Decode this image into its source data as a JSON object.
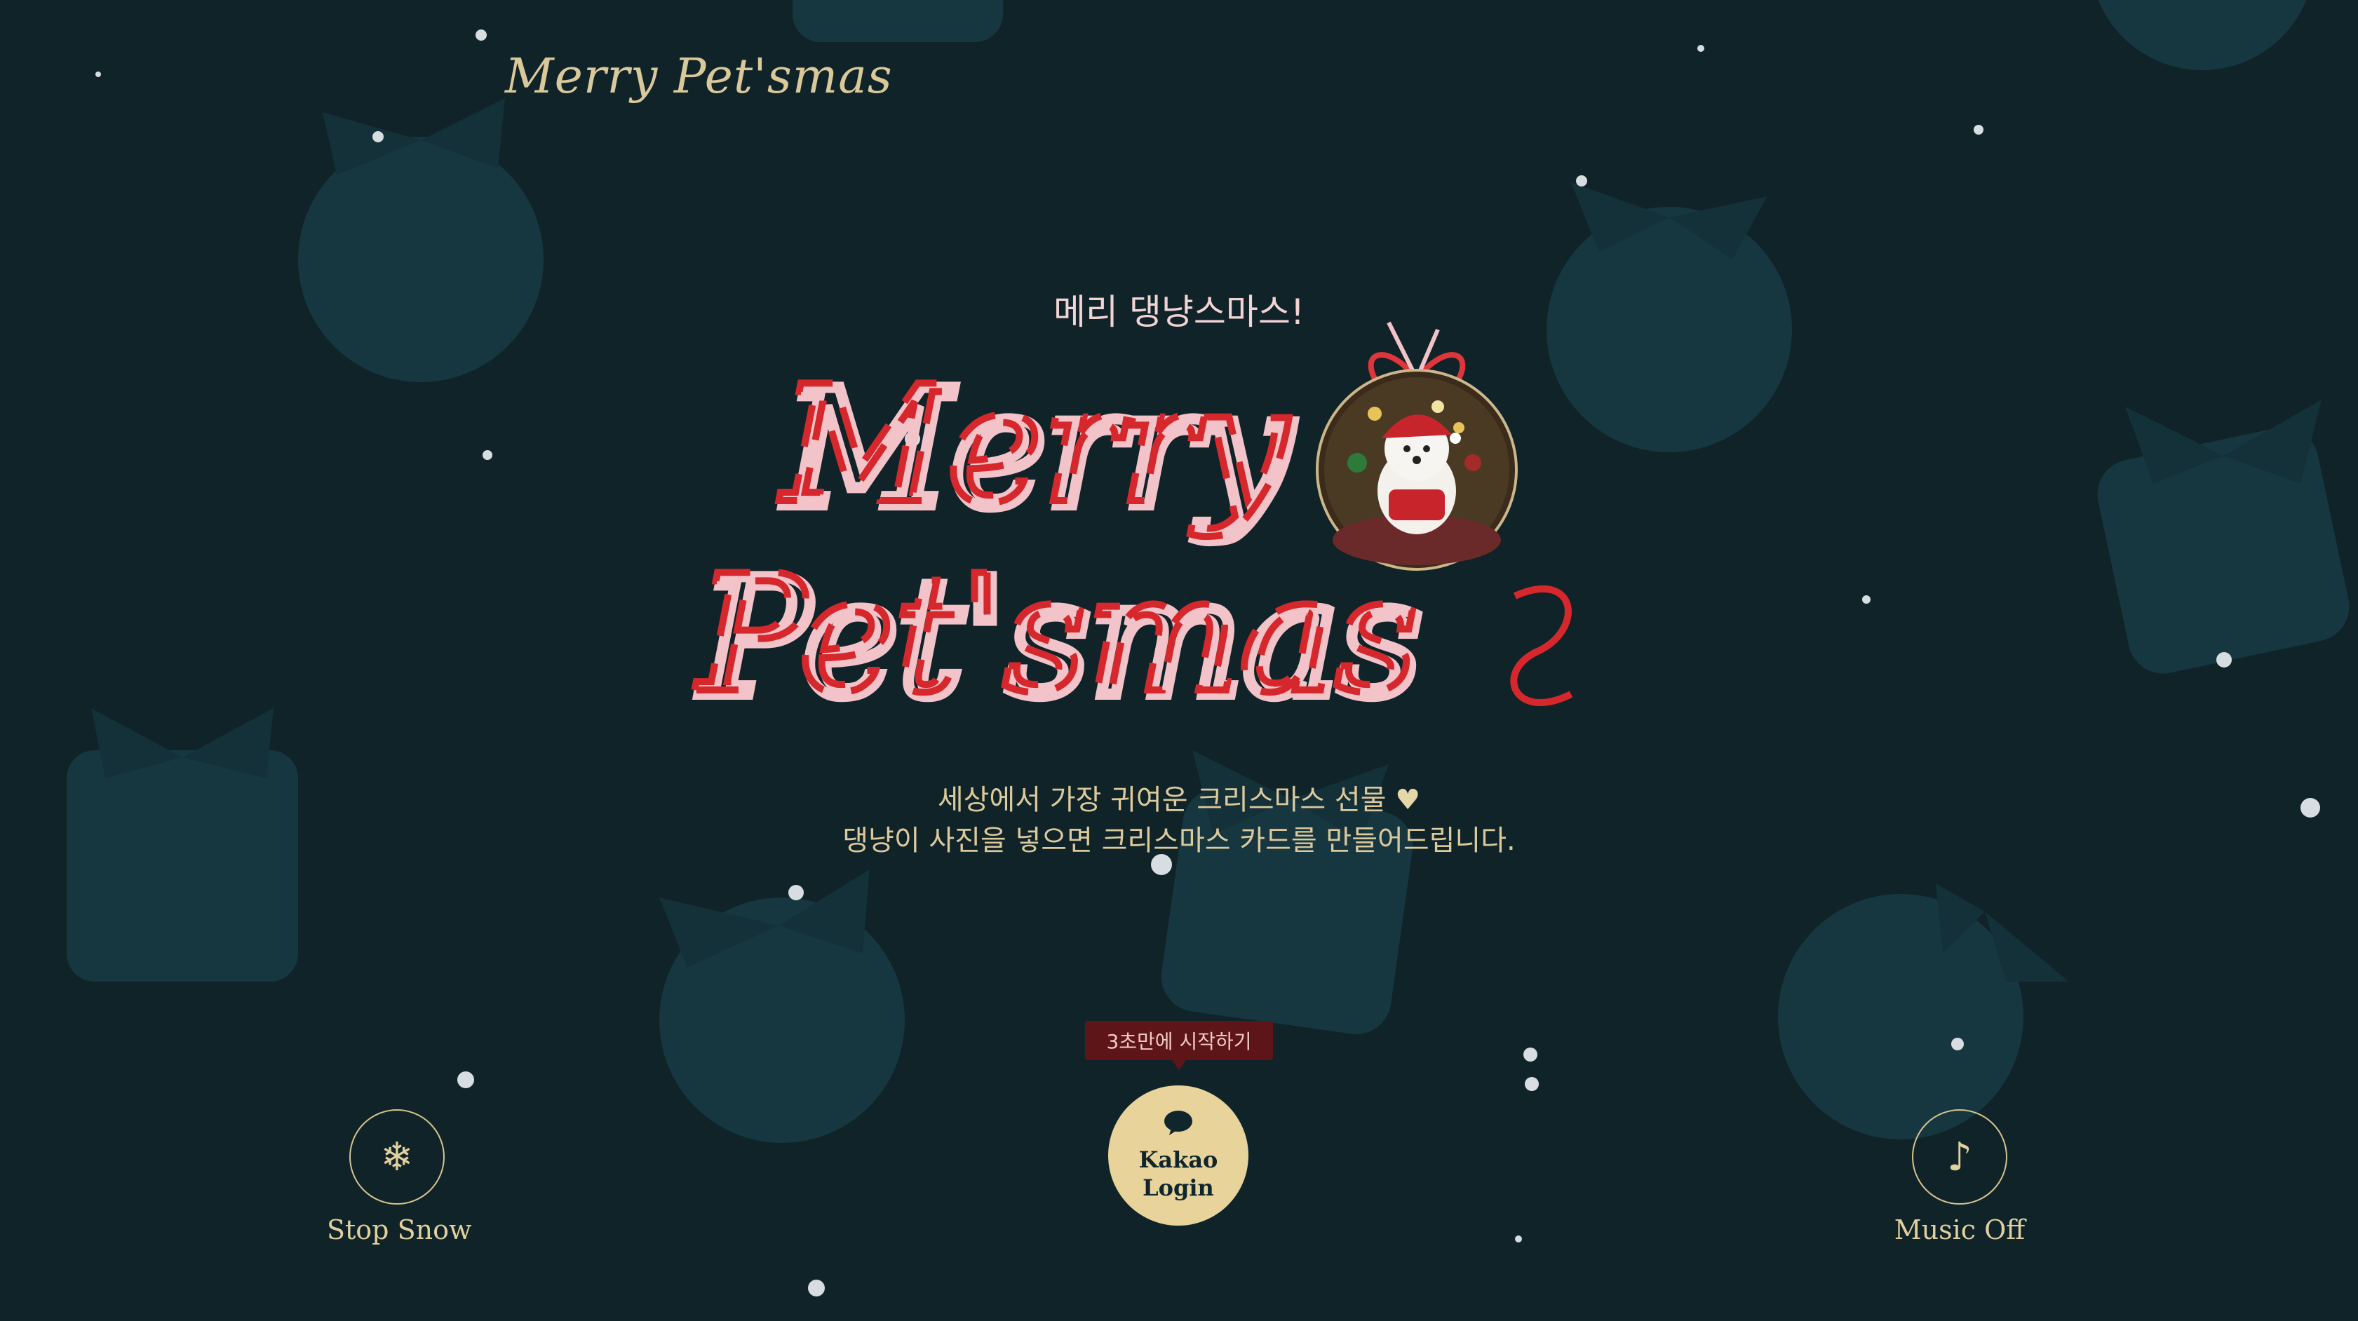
{
  "header": {
    "logo_text": "Merry Pet'smas"
  },
  "hero": {
    "subtitle": "메리 댕냥스마스!",
    "title_line1": "Merry",
    "title_line2": "Pet'smas",
    "description_line1": "세상에서 가장 귀여운 크리스마스 선물",
    "description_line2": "댕냥이 사진을 넣으면 크리스마스 카드를 만들어드립니다.",
    "heart_icon": "♥"
  },
  "controls": {
    "snow": {
      "label": "Stop Snow",
      "icon": "❄"
    },
    "music": {
      "label": "Music Off",
      "icon": "♪"
    }
  },
  "login": {
    "tooltip": "3초만에 시작하기",
    "label": "Kakao Login",
    "icon": "chat-bubble-icon"
  },
  "colors": {
    "background": "#0f2329",
    "accent_gold": "#e8d49b",
    "ribbon_red": "#d6282c",
    "ribbon_pink": "#f2c3c8",
    "tooltip_bg": "#5d1517"
  }
}
